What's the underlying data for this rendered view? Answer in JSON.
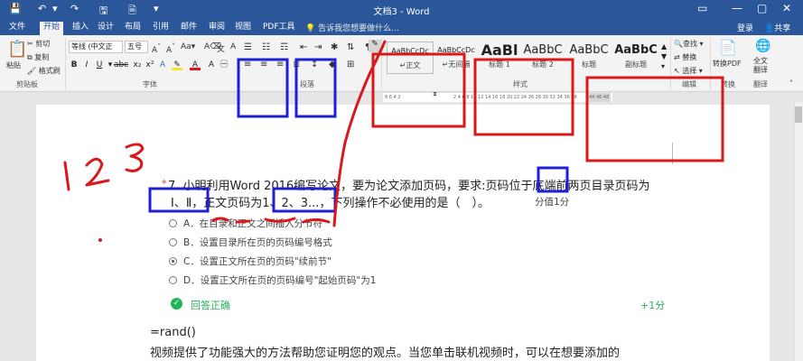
{
  "window": {
    "title": "文档3 - Word",
    "quick_access": [
      "💾",
      "↶",
      "↷",
      "🗎",
      "▾"
    ],
    "controls": [
      "▭",
      "—",
      "▢",
      "✕"
    ]
  },
  "tabs": [
    "文件",
    "开始",
    "插入",
    "设计",
    "布局",
    "引用",
    "邮件",
    "审阅",
    "视图",
    "PDF工具"
  ],
  "tell_me": "告诉我您想要做什么...",
  "account": {
    "login": "登录",
    "share": "共享"
  },
  "ribbon": {
    "clipboard": {
      "paste": "粘贴",
      "cut": "剪切",
      "copy": "复制",
      "format_painter": "格式刷",
      "label": "剪贴板"
    },
    "font": {
      "name": "等线 (中文正",
      "size": "五号",
      "label": "字体"
    },
    "paragraph": {
      "label": "段落"
    },
    "styles": {
      "items": [
        {
          "sample": "AaBbCcDc",
          "name": "↵正文"
        },
        {
          "sample": "AaBbCcDc",
          "name": "↵无间隔"
        },
        {
          "sample": "AaBl",
          "name": "标题 1"
        },
        {
          "sample": "AaBbC",
          "name": "标题 2"
        },
        {
          "sample": "AaBbC",
          "name": "标题"
        },
        {
          "sample": "AaBbC",
          "name": "副标题"
        }
      ],
      "label": "样式"
    },
    "editing": {
      "find": "查找",
      "replace": "替换",
      "select": "选择",
      "label": "编辑"
    },
    "convert": {
      "top": "转换PDF",
      "translate": "全文翻译",
      "pdf_label": "转换",
      "translate_label": "翻译"
    }
  },
  "ruler": {
    "gray": "8 6 4 2",
    "white": "2 4 6 8 10 12 14 16 18 20 22 24 26 28 30 32 34 36 38",
    "right": "44 46 48"
  },
  "document": {
    "question_line1": "7. 小明利用Word 2016编写论文，要为论文添加页码，要求:页码位于底端前两页目录页码为",
    "question_line2": "Ⅰ、Ⅱ，正文页码为1、2、3...，下列操作不必使用的是（　）。",
    "score": "分值1分",
    "options": [
      "A．在目录和正文之间插入分节符",
      "B．设置目录所在页的页码编号格式",
      "C．设置正文所在页的页码\"续前节\"",
      "D．设置正文所在页的页码编号\"起始页码\"为1"
    ],
    "correct_label": "回答正确",
    "points": "+1分",
    "rand": "=rand()",
    "body_line": "视频提供了功能强大的方法帮助您证明您的观点。当您单击联机视频时，可以在想要添加的"
  },
  "annotations": {
    "handwritten": "1 2 3",
    "colors": {
      "blue": "#1f1fd6",
      "red": "#d8181b",
      "brand": "#2b579a",
      "green": "#24b35a"
    }
  }
}
